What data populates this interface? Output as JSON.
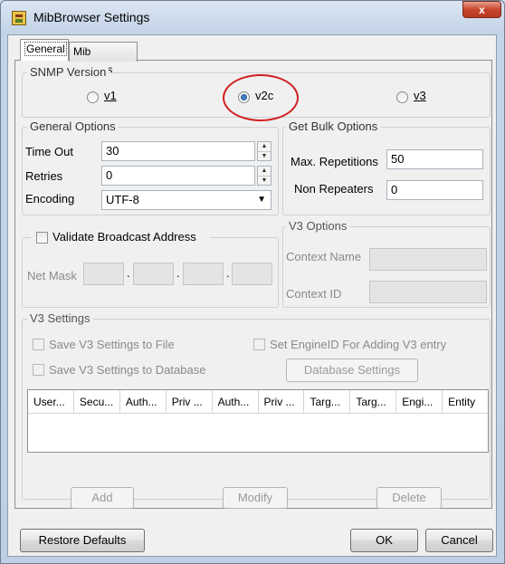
{
  "window": {
    "title": "MibBrowser Settings",
    "close_label": "x"
  },
  "tabs": [
    {
      "label": "General"
    },
    {
      "label": "Mib Settings"
    }
  ],
  "snmp_version": {
    "legend": "SNMP Version",
    "options": [
      {
        "label": "v1",
        "selected": false
      },
      {
        "label": "v2c",
        "selected": true
      },
      {
        "label": "v3",
        "selected": false
      }
    ]
  },
  "general_options": {
    "legend": "General Options",
    "timeout": {
      "label": "Time Out",
      "value": "30"
    },
    "retries": {
      "label": "Retries",
      "value": "0"
    },
    "encoding": {
      "label": "Encoding",
      "value": "UTF-8"
    }
  },
  "get_bulk": {
    "legend": "Get Bulk Options",
    "max_repetitions": {
      "label": "Max. Repetitions",
      "value": "50"
    },
    "non_repeaters": {
      "label": "Non Repeaters",
      "value": "0"
    }
  },
  "broadcast": {
    "checkbox_label": "Validate Broadcast Address",
    "net_mask_label": "Net Mask",
    "separator": "."
  },
  "v3_options": {
    "legend": "V3 Options",
    "context_name_label": "Context Name",
    "context_id_label": "Context ID"
  },
  "v3_settings": {
    "legend": "V3 Settings",
    "save_file": "Save V3 Settings to File",
    "save_db": "Save V3 Settings to Database",
    "set_engine": "Set EngineID For Adding V3 entry",
    "db_settings_button": "Database Settings",
    "columns": [
      "User...",
      "Secu...",
      "Auth...",
      "Priv ...",
      "Auth...",
      "Priv ...",
      "Targ...",
      "Targ...",
      "Engi...",
      "Entity"
    ],
    "add": "Add",
    "modify": "Modify",
    "delete": "Delete"
  },
  "footer": {
    "restore": "Restore Defaults",
    "ok": "OK",
    "cancel": "Cancel"
  }
}
